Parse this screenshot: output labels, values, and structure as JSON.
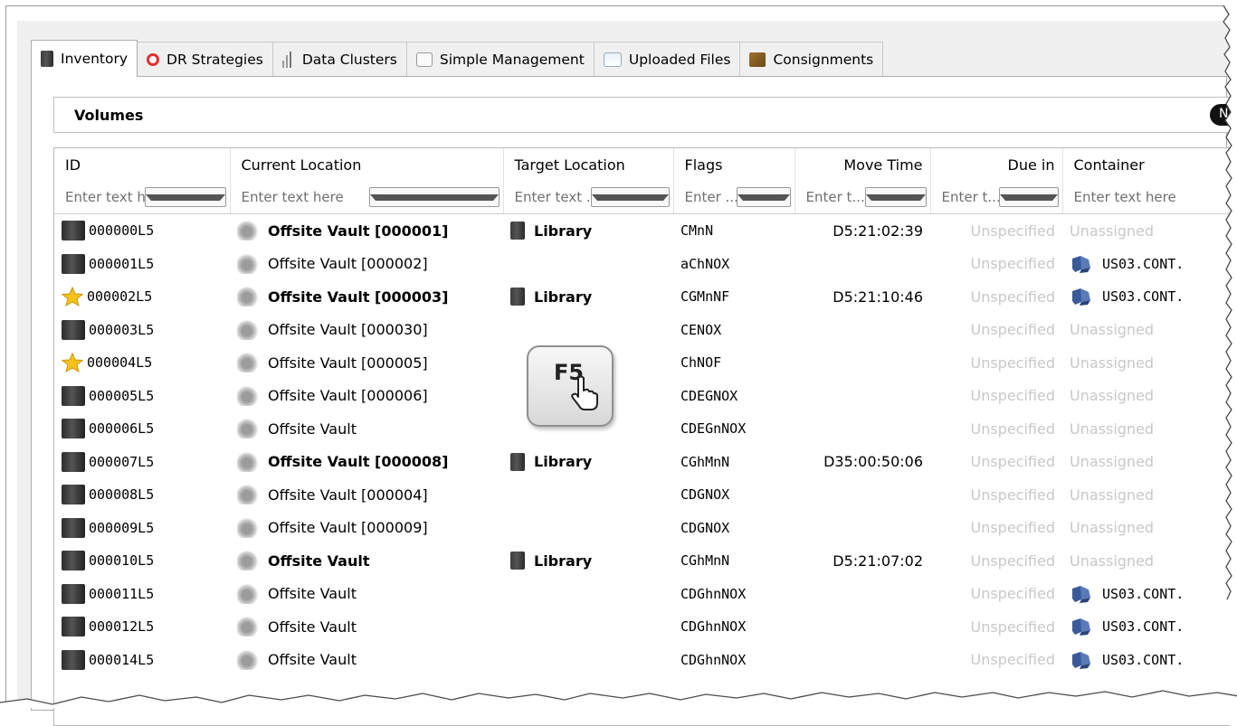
{
  "tabs": [
    {
      "label": "Inventory",
      "icon": "drive-icon",
      "active": true
    },
    {
      "label": "DR Strategies",
      "icon": "lifebuoy-icon",
      "active": false
    },
    {
      "label": "Data Clusters",
      "icon": "cluster-icon",
      "active": false
    },
    {
      "label": "Simple Management",
      "icon": "management-icon",
      "active": false
    },
    {
      "label": "Uploaded Files",
      "icon": "window-icon",
      "active": false
    },
    {
      "label": "Consignments",
      "icon": "box-icon",
      "active": false
    }
  ],
  "section": {
    "title": "Volumes",
    "button_label": "N"
  },
  "columns": [
    {
      "label": "ID",
      "filter_placeholder": "Enter text h..."
    },
    {
      "label": "Current Location",
      "filter_placeholder": "Enter text here"
    },
    {
      "label": "Target Location",
      "filter_placeholder": "Enter text ..."
    },
    {
      "label": "Flags",
      "filter_placeholder": "Enter ..."
    },
    {
      "label": "Move Time",
      "filter_placeholder": "Enter t..."
    },
    {
      "label": "Due in",
      "filter_placeholder": "Enter t..."
    },
    {
      "label": "Container",
      "filter_placeholder": "Enter text here"
    }
  ],
  "rows": [
    {
      "id": "000000L5",
      "starred": false,
      "current": "Offsite Vault [000001]",
      "bold": true,
      "target": "Library",
      "flags": "CMnN",
      "move": "D5:21:02:39",
      "due": "Unspecified",
      "container": "Unassigned",
      "has_container": false
    },
    {
      "id": "000001L5",
      "starred": false,
      "current": "Offsite Vault [000002]",
      "bold": false,
      "target": "",
      "flags": "aChNOX",
      "move": "",
      "due": "Unspecified",
      "container": "US03.CONT.",
      "has_container": true
    },
    {
      "id": "000002L5",
      "starred": true,
      "current": "Offsite Vault [000003]",
      "bold": true,
      "target": "Library",
      "flags": "CGMnNF",
      "move": "D5:21:10:46",
      "due": "Unspecified",
      "container": "US03.CONT.",
      "has_container": true
    },
    {
      "id": "000003L5",
      "starred": false,
      "current": "Offsite Vault [000030]",
      "bold": false,
      "target": "",
      "flags": "CENOX",
      "move": "",
      "due": "Unspecified",
      "container": "Unassigned",
      "has_container": false
    },
    {
      "id": "000004L5",
      "starred": true,
      "current": "Offsite Vault [000005]",
      "bold": false,
      "target": "",
      "flags": "ChNOF",
      "move": "",
      "due": "Unspecified",
      "container": "Unassigned",
      "has_container": false
    },
    {
      "id": "000005L5",
      "starred": false,
      "current": "Offsite Vault [000006]",
      "bold": false,
      "target": "",
      "flags": "CDEGNOX",
      "move": "",
      "due": "Unspecified",
      "container": "Unassigned",
      "has_container": false
    },
    {
      "id": "000006L5",
      "starred": false,
      "current": "Offsite Vault",
      "bold": false,
      "target": "",
      "flags": "CDEGnNOX",
      "move": "",
      "due": "Unspecified",
      "container": "Unassigned",
      "has_container": false
    },
    {
      "id": "000007L5",
      "starred": false,
      "current": "Offsite Vault [000008]",
      "bold": true,
      "target": "Library",
      "flags": "CGhMnN",
      "move": "D35:00:50:06",
      "due": "Unspecified",
      "container": "Unassigned",
      "has_container": false
    },
    {
      "id": "000008L5",
      "starred": false,
      "current": "Offsite Vault [000004]",
      "bold": false,
      "target": "",
      "flags": "CDGNOX",
      "move": "",
      "due": "Unspecified",
      "container": "Unassigned",
      "has_container": false
    },
    {
      "id": "000009L5",
      "starred": false,
      "current": "Offsite Vault [000009]",
      "bold": false,
      "target": "",
      "flags": "CDGNOX",
      "move": "",
      "due": "Unspecified",
      "container": "Unassigned",
      "has_container": false
    },
    {
      "id": "000010L5",
      "starred": false,
      "current": "Offsite Vault",
      "bold": true,
      "target": "Library",
      "flags": "CGhMnN",
      "move": "D5:21:07:02",
      "due": "Unspecified",
      "container": "Unassigned",
      "has_container": false
    },
    {
      "id": "000011L5",
      "starred": false,
      "current": "Offsite Vault",
      "bold": false,
      "target": "",
      "flags": "CDGhnNOX",
      "move": "",
      "due": "Unspecified",
      "container": "US03.CONT.",
      "has_container": true
    },
    {
      "id": "000012L5",
      "starred": false,
      "current": "Offsite Vault",
      "bold": false,
      "target": "",
      "flags": "CDGhnNOX",
      "move": "",
      "due": "Unspecified",
      "container": "US03.CONT.",
      "has_container": true
    },
    {
      "id": "000014L5",
      "starred": false,
      "current": "Offsite Vault",
      "bold": false,
      "target": "",
      "flags": "CDGhnNOX",
      "move": "",
      "due": "Unspecified",
      "container": "US03.CONT.",
      "has_container": true
    }
  ],
  "key_hint": {
    "label": "F5"
  }
}
